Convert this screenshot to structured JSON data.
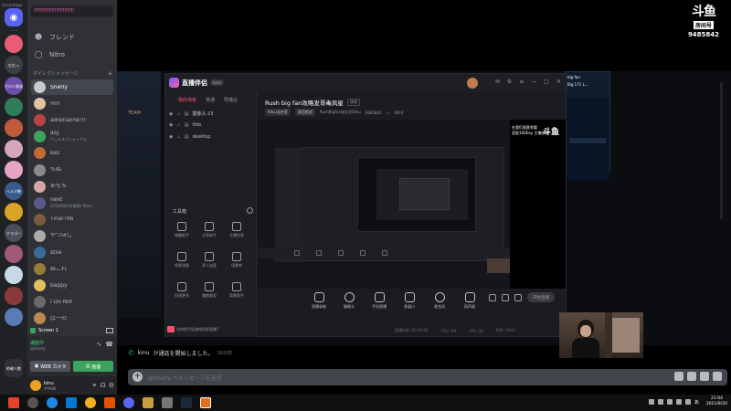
{
  "window": {
    "title": "discordapp"
  },
  "rail": {
    "home_icon": "discord-icon",
    "servers": [
      {
        "label": "",
        "color": "#e85d75"
      },
      {
        "label": "むむっ",
        "color": "#3b3f45"
      },
      {
        "label": "ゼロミ鉄道",
        "color": "#6b4fa8"
      },
      {
        "label": "",
        "color": "#2e7d5b"
      },
      {
        "label": "",
        "color": "#c05a3a"
      },
      {
        "label": "",
        "color": "#d4a6b8"
      },
      {
        "label": "",
        "color": "#e7a4c4"
      },
      {
        "label": "ヘルマ勢",
        "color": "#3a5a8a"
      },
      {
        "label": "",
        "color": "#d9a326"
      },
      {
        "label": "ドラゴー",
        "color": "#4a4f5a"
      },
      {
        "label": "",
        "color": "#a05a78"
      },
      {
        "label": "",
        "color": "#c7d8e8"
      },
      {
        "label": "",
        "color": "#8a3a3a"
      },
      {
        "label": "",
        "color": "#5a7ab8"
      }
    ],
    "bottom_label": "的確人数"
  },
  "dm_panel": {
    "search_text": "!!!!!!!!!!!!!!!!!!!!!!!!!!!!!",
    "search_hint": "会話に参加または作成",
    "nav_friends": "フレンド",
    "nav_nitro": "Nitro",
    "section_label": "ダイレクトメッセージ",
    "items": [
      {
        "name": "Sherly",
        "sub": "",
        "color": "#c9c9c9",
        "active": true
      },
      {
        "name": "mrr",
        "sub": "",
        "color": "#e1c3a1"
      },
      {
        "name": "adrenaline!!!",
        "sub": "",
        "color": "#b44"
      },
      {
        "name": "aSJ",
        "sub": "ウェルスパジャックス...",
        "color": "#3ba55d"
      },
      {
        "name": "kes",
        "sub": "",
        "color": "#c06a3a"
      },
      {
        "name": "ちぬ",
        "sub": "",
        "color": "#8a8a8a"
      },
      {
        "name": "おもち",
        "sub": "",
        "color": "#d6a6a6"
      },
      {
        "name": "next",
        "sub": "LIP1000LP目指NA Mort...",
        "color": "#5a5a8a"
      },
      {
        "name": "Tina!?ll6",
        "sub": "",
        "color": "#7a5a3a"
      },
      {
        "name": "やつほし",
        "sub": "",
        "color": "#aaa"
      },
      {
        "name": "stile",
        "sub": "",
        "color": "#3a6a9a"
      },
      {
        "name": "ぬこれ",
        "sub": "",
        "color": "#9a7a3a"
      },
      {
        "name": "bappy",
        "sub": "",
        "color": "#e0c060"
      },
      {
        "name": "I Do Not",
        "sub": "",
        "color": "#6a6a6a"
      },
      {
        "name": "ぱーの",
        "sub": "",
        "color": "#b85"
      }
    ]
  },
  "voice": {
    "screen_label": "Screen 1",
    "status": "通話中",
    "sub": "@Sherly",
    "webcam_btn": "WEB カメラ",
    "screen_btn": "画面",
    "user_name": "kinu",
    "user_tag": "#9988"
  },
  "main": {
    "chat_user": "kinu",
    "chat_text": "が通話を開始しました。",
    "chat_time": "16分前",
    "input_placeholder": "@Sherly へメッセージを送信",
    "lol_team": "TEAM",
    "right_panel_title": "big fan",
    "right_panel_sub": "Big 171 L..."
  },
  "douyu": {
    "logo": "斗鱼",
    "room_label": "房间号",
    "room_number": "9485842"
  },
  "app": {
    "name": "直播伴侣",
    "version": "beta",
    "tabs": [
      "我的场景",
      "普通",
      "导播台"
    ],
    "scenes": [
      "图像头 23",
      "title",
      "desktop"
    ],
    "tools_title": "工具箱",
    "tools": [
      {
        "label": "弹幕助手"
      },
      {
        "label": "分享助手"
      },
      {
        "label": "主播信息"
      },
      {
        "label": "视频流量"
      },
      {
        "label": "多人连麦"
      },
      {
        "label": "场景库"
      },
      {
        "label": "旧版更多"
      },
      {
        "label": "美颜美型"
      },
      {
        "label": "背景助手"
      }
    ],
    "bottom_note": "如何把手机游戏投屏直播?",
    "room_title": "Rush big fan攻略发哥毒风星",
    "room_edit": "修改",
    "room_tags": [
      "Kitsu混合室",
      "莫西斯战"
    ],
    "room_host": "RushBigFan攻比学Sitsu",
    "room_id": "9485842",
    "room_heat": "4910",
    "preview_text_1": "在我们直跌到看",
    "preview_text_2": "奖励100Exp 主播经验",
    "preview_logo": "斗鱼",
    "controls": [
      "直播录制",
      "摄像头",
      "手机直播",
      "多窗口",
      "麦克风",
      "扬声器"
    ],
    "start_btn": "开始直播",
    "status_items": [
      "直播时长: 00:00:00",
      "CPU: 9%",
      "FPS: 30",
      "码率: 0kb/s"
    ]
  },
  "taskbar": {
    "lang": "あ",
    "time": "21:04",
    "date": "2021/8/20"
  }
}
